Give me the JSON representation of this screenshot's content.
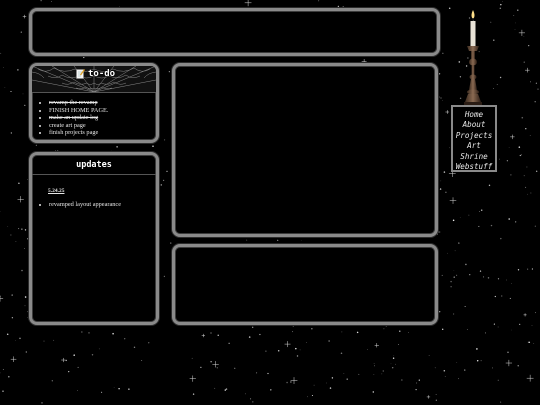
{
  "todo": {
    "title": "to-do",
    "icon": "memo-icon",
    "items": [
      {
        "text": "revamp the revamp",
        "done": true
      },
      {
        "text": "FINISH HOME PAGE.",
        "done": false
      },
      {
        "text": "make an update log",
        "done": true
      },
      {
        "text": "create art page",
        "done": false
      },
      {
        "text": "finish projects page",
        "done": false
      }
    ]
  },
  "updates": {
    "title": "updates",
    "entries": [
      {
        "date": "5.24.25",
        "items": [
          "revamped layout appearance"
        ]
      }
    ]
  },
  "nav": {
    "items": [
      {
        "label": "Home"
      },
      {
        "label": "About"
      },
      {
        "label": "Projects"
      },
      {
        "label": "Art"
      },
      {
        "label": "Shrine"
      },
      {
        "label": "Webstuff"
      }
    ]
  },
  "decor": {
    "background": "starfield",
    "nav_ornament": "candle-icon"
  },
  "colors": {
    "background": "#000000",
    "panel_border": "#8a8a8a",
    "text": "#e6e6e6"
  }
}
